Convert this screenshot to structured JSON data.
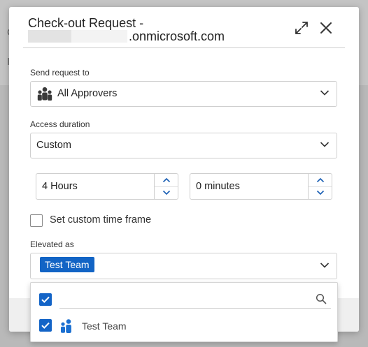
{
  "dialog": {
    "title_line1": "Check-out Request -",
    "title_line2": ".onmicrosoft.com",
    "expand_icon": "expand-arrows-icon",
    "close_icon": "close-x-icon"
  },
  "send_request": {
    "label": "Send request to",
    "value": "All Approvers",
    "icon": "group-people-icon"
  },
  "access_duration": {
    "label": "Access duration",
    "value": "Custom"
  },
  "duration": {
    "hours": "4 Hours",
    "minutes": "0 minutes"
  },
  "custom_time_frame": {
    "label": "Set custom time frame",
    "checked": false
  },
  "elevated_as": {
    "label": "Elevated as",
    "selected_tags": [
      "Test Team"
    ]
  },
  "dropdown": {
    "search_value": "",
    "select_all_checked": true,
    "options": [
      {
        "label": "Test Team",
        "checked": true,
        "icon": "group-people-icon"
      }
    ]
  },
  "colors": {
    "accent": "#1264c5",
    "backdrop": "#b9b9b9"
  }
}
